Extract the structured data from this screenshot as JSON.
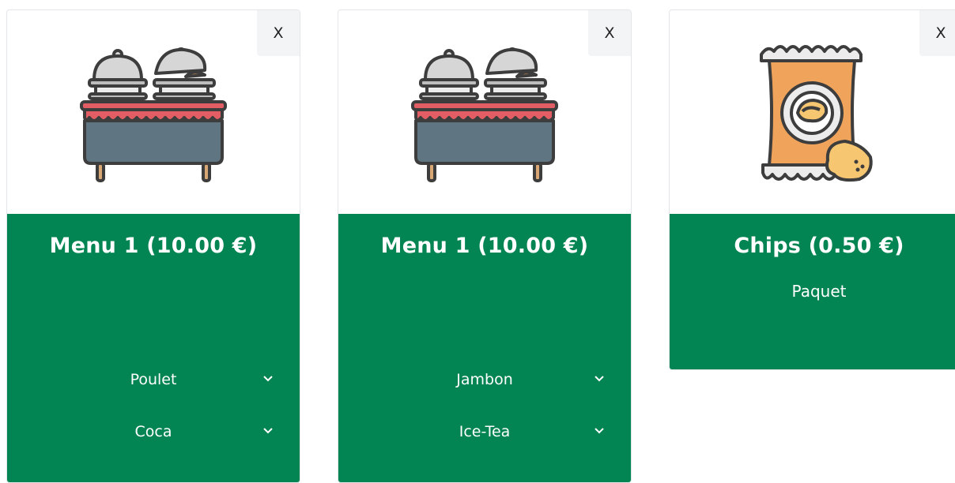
{
  "close_label": "X",
  "colors": {
    "card_body": "#038553",
    "close_bg": "#f3f4f6",
    "text": "#ffffff"
  },
  "cards": [
    {
      "image_icon": "buffet-table-icon",
      "title": "Menu 1 (10.00 €)",
      "selects": [
        {
          "value": "Poulet",
          "icon": "chevron-down-icon"
        },
        {
          "value": "Coca",
          "icon": "chevron-down-icon"
        }
      ]
    },
    {
      "image_icon": "buffet-table-icon",
      "title": "Menu 1 (10.00 €)",
      "selects": [
        {
          "value": "Jambon",
          "icon": "chevron-down-icon"
        },
        {
          "value": "Ice-Tea",
          "icon": "chevron-down-icon"
        }
      ]
    },
    {
      "image_icon": "chips-bag-icon",
      "title": "Chips (0.50 €)",
      "subtitle": "Paquet"
    }
  ]
}
